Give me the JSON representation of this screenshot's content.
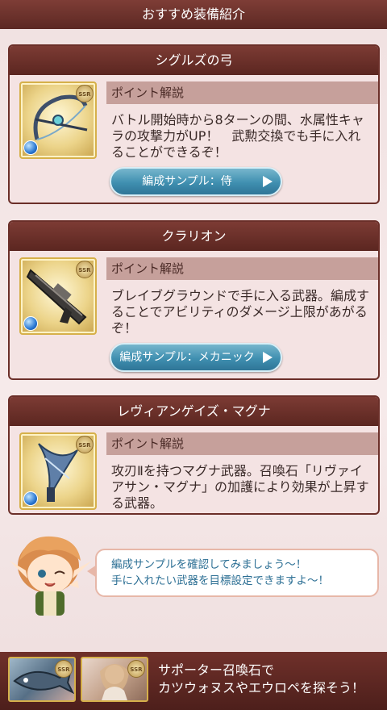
{
  "header": {
    "title": "おすすめ装備紹介"
  },
  "cards": [
    {
      "title": "シグルズの弓",
      "point_label": "ポイント解説",
      "description": "バトル開始時から8ターンの間、水属性キャラの攻撃力がUP！　武勲交換でも手に入れることができるぞ！",
      "button": "編成サンプル：侍",
      "rarity": "SSR"
    },
    {
      "title": "クラリオン",
      "point_label": "ポイント解説",
      "description": "ブレイブグラウンドで手に入る武器。編成することでアビリティのダメージ上限があがるぞ！",
      "button": "編成サンプル：メカニック",
      "rarity": "SSR"
    },
    {
      "title": "レヴィアンゲイズ・マグナ",
      "point_label": "ポイント解説",
      "description": "攻刃Ⅱを持つマグナ武器。召喚石「リヴァイアサン・マグナ」の加護により効果が上昇する武器。",
      "rarity": "SSR"
    }
  ],
  "speech": {
    "line1": "編成サンプルを確認してみましょう～！",
    "line2": "手に入れたい武器を目標設定できますよ～！"
  },
  "footer": {
    "line1": "サポーター召喚石で",
    "line2": "カツウォヌスやエウロペを探そう！",
    "rarity": "SSR"
  },
  "colors": {
    "accent": "#6b2f29",
    "button": "#3f8fb0",
    "speech_text": "#2c6f94"
  }
}
